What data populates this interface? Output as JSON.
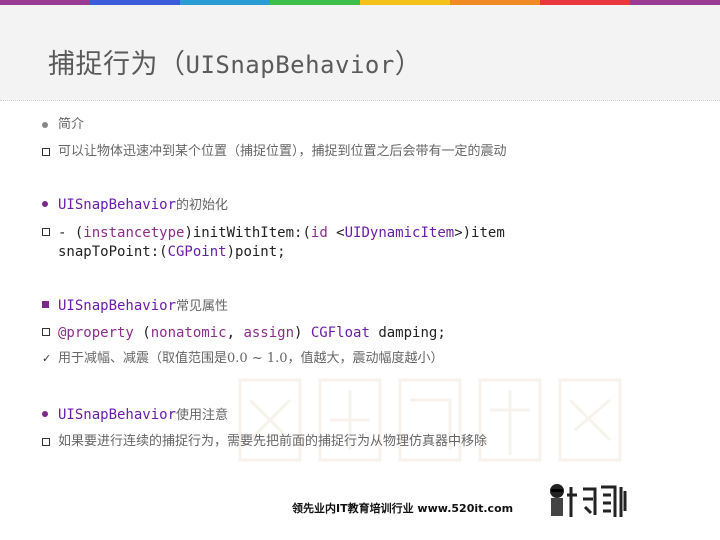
{
  "stripe_colors": [
    "#9b3a93",
    "#3b5bdb",
    "#2b9bd6",
    "#3cbf4b",
    "#f3c11a",
    "#f08a24",
    "#e8383d",
    "#9b3a93"
  ],
  "title": {
    "main": "捕捉行为（",
    "latin": "UISnapBehavior",
    "close": "）"
  },
  "intro": {
    "heading": "简介",
    "desc": "可以让物体迅速冲到某个位置（捕捉位置），捕捉到位置之后会带有一定的震动"
  },
  "init": {
    "heading_code": "UISnapBehavior",
    "heading_text": "的初始化",
    "line1": {
      "a": "- (",
      "b": "instancetype",
      "c": ")initWithItem:(",
      "d": "id",
      "e": " <",
      "f": "UIDynamicItem",
      "g": ">)item"
    },
    "line2": {
      "a": "snapToPoint:(",
      "b": "CGPoint",
      "c": ")point;"
    }
  },
  "props": {
    "heading_code": "UISnapBehavior",
    "heading_text": "常见属性",
    "code": {
      "a": "@property",
      "b": " (",
      "c": "nonatomic",
      "d": ", ",
      "e": "assign",
      "f": ") ",
      "g": "CGFloat",
      "h": " damping;"
    },
    "note": "用于减幅、减震（取值范围是0.0 ~ 1.0，值越大，震动幅度越小）"
  },
  "usage": {
    "heading_code": "UISnapBehavior",
    "heading_text": "使用注意",
    "desc": "如果要进行连续的捕捉行为，需要先把前面的捕捉行为从物理仿真器中移除"
  },
  "footer": {
    "text": "领先业内IT教育培训行业 www.520it.com"
  },
  "colors": {
    "accent": "#8a2e8a",
    "class": "#6a1ea8",
    "purple_bullet": "#7b2a8a"
  }
}
